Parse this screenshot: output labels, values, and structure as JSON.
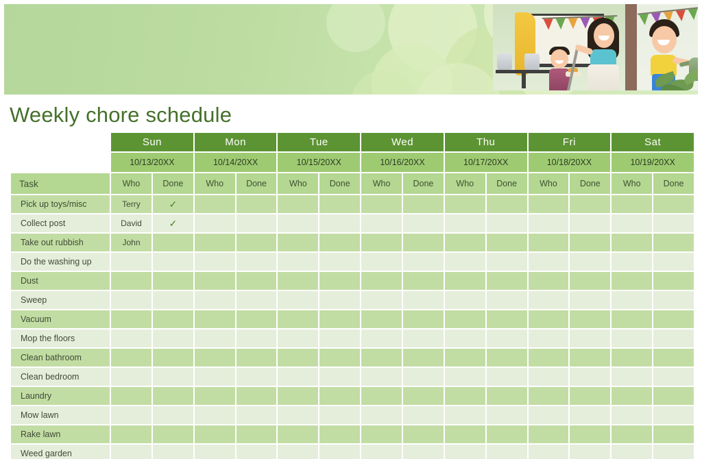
{
  "page": {
    "title": "Weekly chore schedule"
  },
  "banner": {
    "illustration_name": "family-doing-chores-illustration",
    "accent_dark_green": "#5d9433",
    "accent_mid_green": "#9ecb72",
    "accent_light_green": "#b4d792",
    "row_alt_a": "#c2dda3",
    "row_alt_b": "#e5eedb",
    "title_color": "#45702a"
  },
  "table": {
    "task_column_header": "Task",
    "sub_headers": [
      "Who",
      "Done"
    ],
    "days": [
      {
        "name": "Sun",
        "date": "10/13/20XX"
      },
      {
        "name": "Mon",
        "date": "10/14/20XX"
      },
      {
        "name": "Tue",
        "date": "10/15/20XX"
      },
      {
        "name": "Wed",
        "date": "10/16/20XX"
      },
      {
        "name": "Thu",
        "date": "10/17/20XX"
      },
      {
        "name": "Fri",
        "date": "10/18/20XX"
      },
      {
        "name": "Sat",
        "date": "10/19/20XX"
      }
    ],
    "check_glyph": "✓",
    "rows": [
      {
        "task": "Pick up toys/misc",
        "cells": [
          {
            "who": "Terry",
            "done": "✓"
          },
          {
            "who": "",
            "done": ""
          },
          {
            "who": "",
            "done": ""
          },
          {
            "who": "",
            "done": ""
          },
          {
            "who": "",
            "done": ""
          },
          {
            "who": "",
            "done": ""
          },
          {
            "who": "",
            "done": ""
          }
        ]
      },
      {
        "task": "Collect post",
        "cells": [
          {
            "who": "David",
            "done": "✓"
          },
          {
            "who": "",
            "done": ""
          },
          {
            "who": "",
            "done": ""
          },
          {
            "who": "",
            "done": ""
          },
          {
            "who": "",
            "done": ""
          },
          {
            "who": "",
            "done": ""
          },
          {
            "who": "",
            "done": ""
          }
        ]
      },
      {
        "task": "Take out rubbish",
        "cells": [
          {
            "who": "John",
            "done": ""
          },
          {
            "who": "",
            "done": ""
          },
          {
            "who": "",
            "done": ""
          },
          {
            "who": "",
            "done": ""
          },
          {
            "who": "",
            "done": ""
          },
          {
            "who": "",
            "done": ""
          },
          {
            "who": "",
            "done": ""
          }
        ]
      },
      {
        "task": "Do the washing up",
        "cells": [
          {
            "who": "",
            "done": ""
          },
          {
            "who": "",
            "done": ""
          },
          {
            "who": "",
            "done": ""
          },
          {
            "who": "",
            "done": ""
          },
          {
            "who": "",
            "done": ""
          },
          {
            "who": "",
            "done": ""
          },
          {
            "who": "",
            "done": ""
          }
        ]
      },
      {
        "task": "Dust",
        "cells": [
          {
            "who": "",
            "done": ""
          },
          {
            "who": "",
            "done": ""
          },
          {
            "who": "",
            "done": ""
          },
          {
            "who": "",
            "done": ""
          },
          {
            "who": "",
            "done": ""
          },
          {
            "who": "",
            "done": ""
          },
          {
            "who": "",
            "done": ""
          }
        ]
      },
      {
        "task": "Sweep",
        "cells": [
          {
            "who": "",
            "done": ""
          },
          {
            "who": "",
            "done": ""
          },
          {
            "who": "",
            "done": ""
          },
          {
            "who": "",
            "done": ""
          },
          {
            "who": "",
            "done": ""
          },
          {
            "who": "",
            "done": ""
          },
          {
            "who": "",
            "done": ""
          }
        ]
      },
      {
        "task": "Vacuum",
        "cells": [
          {
            "who": "",
            "done": ""
          },
          {
            "who": "",
            "done": ""
          },
          {
            "who": "",
            "done": ""
          },
          {
            "who": "",
            "done": ""
          },
          {
            "who": "",
            "done": ""
          },
          {
            "who": "",
            "done": ""
          },
          {
            "who": "",
            "done": ""
          }
        ]
      },
      {
        "task": "Mop the floors",
        "cells": [
          {
            "who": "",
            "done": ""
          },
          {
            "who": "",
            "done": ""
          },
          {
            "who": "",
            "done": ""
          },
          {
            "who": "",
            "done": ""
          },
          {
            "who": "",
            "done": ""
          },
          {
            "who": "",
            "done": ""
          },
          {
            "who": "",
            "done": ""
          }
        ]
      },
      {
        "task": "Clean bathroom",
        "cells": [
          {
            "who": "",
            "done": ""
          },
          {
            "who": "",
            "done": ""
          },
          {
            "who": "",
            "done": ""
          },
          {
            "who": "",
            "done": ""
          },
          {
            "who": "",
            "done": ""
          },
          {
            "who": "",
            "done": ""
          },
          {
            "who": "",
            "done": ""
          }
        ]
      },
      {
        "task": "Clean bedroom",
        "cells": [
          {
            "who": "",
            "done": ""
          },
          {
            "who": "",
            "done": ""
          },
          {
            "who": "",
            "done": ""
          },
          {
            "who": "",
            "done": ""
          },
          {
            "who": "",
            "done": ""
          },
          {
            "who": "",
            "done": ""
          },
          {
            "who": "",
            "done": ""
          }
        ]
      },
      {
        "task": "Laundry",
        "cells": [
          {
            "who": "",
            "done": ""
          },
          {
            "who": "",
            "done": ""
          },
          {
            "who": "",
            "done": ""
          },
          {
            "who": "",
            "done": ""
          },
          {
            "who": "",
            "done": ""
          },
          {
            "who": "",
            "done": ""
          },
          {
            "who": "",
            "done": ""
          }
        ]
      },
      {
        "task": "Mow lawn",
        "cells": [
          {
            "who": "",
            "done": ""
          },
          {
            "who": "",
            "done": ""
          },
          {
            "who": "",
            "done": ""
          },
          {
            "who": "",
            "done": ""
          },
          {
            "who": "",
            "done": ""
          },
          {
            "who": "",
            "done": ""
          },
          {
            "who": "",
            "done": ""
          }
        ]
      },
      {
        "task": "Rake lawn",
        "cells": [
          {
            "who": "",
            "done": ""
          },
          {
            "who": "",
            "done": ""
          },
          {
            "who": "",
            "done": ""
          },
          {
            "who": "",
            "done": ""
          },
          {
            "who": "",
            "done": ""
          },
          {
            "who": "",
            "done": ""
          },
          {
            "who": "",
            "done": ""
          }
        ]
      },
      {
        "task": "Weed garden",
        "cells": [
          {
            "who": "",
            "done": ""
          },
          {
            "who": "",
            "done": ""
          },
          {
            "who": "",
            "done": ""
          },
          {
            "who": "",
            "done": ""
          },
          {
            "who": "",
            "done": ""
          },
          {
            "who": "",
            "done": ""
          },
          {
            "who": "",
            "done": ""
          }
        ]
      }
    ]
  }
}
